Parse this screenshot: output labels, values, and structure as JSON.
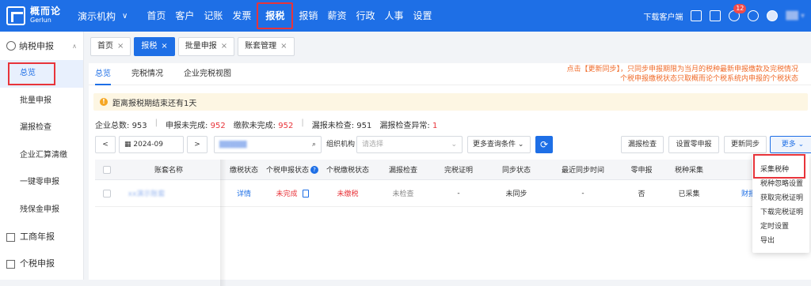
{
  "brand": {
    "name_cn": "概而论",
    "name_en": "Gerlun"
  },
  "org": {
    "name": "演示机构"
  },
  "nav": [
    "首页",
    "客户",
    "记账",
    "发票",
    "报税",
    "报销",
    "薪资",
    "行政",
    "人事",
    "设置"
  ],
  "topright": {
    "download": "下载客户端",
    "badge": "12"
  },
  "sidebar": {
    "header": "纳税申报",
    "items": [
      "总览",
      "批量申报",
      "漏报检查",
      "企业汇算清缴",
      "一键零申报",
      "残保金申报"
    ],
    "sections": [
      "工商年报",
      "个税申报"
    ]
  },
  "tabs": [
    {
      "label": "首页",
      "close": "×"
    },
    {
      "label": "报税",
      "close": "×"
    },
    {
      "label": "批量申报",
      "close": "×"
    },
    {
      "label": "账套管理",
      "close": "×"
    }
  ],
  "subtabs": [
    "总览",
    "完税情况",
    "企业完税视图"
  ],
  "notice": {
    "line1": "点击【更新同步】，只同步申报期限为当月的税种最新申报缴款及完税情况",
    "line2": "个税申报缴税状态只取概而论个税系统内申报的个税状态"
  },
  "alert": {
    "icon": "!",
    "text": "距离报税期结束还有1天"
  },
  "stats": {
    "total_label": "企业总数:",
    "total": "953",
    "unfiled_label": "申报未完成:",
    "unfiled": "952",
    "unpaid_label": "缴款未完成:",
    "unpaid": "952",
    "unchecked_label": "漏报未检查:",
    "unchecked": "951",
    "abnormal_label": "漏报检查异常:",
    "abnormal": "1",
    "sep": "|"
  },
  "toolbar": {
    "prev": "<",
    "next": ">",
    "period": "2024-09",
    "org_label": "组织机构",
    "org_placeholder": "请选择",
    "more_filters": "更多查询条件",
    "btn_check": "漏报检查",
    "btn_zero": "设置零申报",
    "btn_sync": "更新同步",
    "btn_more": "更多"
  },
  "table": {
    "headers": [
      "账套名称",
      "缴税状态",
      "个税申报状态",
      "个税缴税状态",
      "漏报检查",
      "完税证明",
      "同步状态",
      "最近同步时间",
      "零申报",
      "税种采集"
    ],
    "row": {
      "name": "xx演示账套",
      "tax_detail": "详情",
      "iit_status": "未完成",
      "iit_pay": "未缴税",
      "check": "未检查",
      "proof": "-",
      "sync": "未同步",
      "last_sync": "-",
      "zero": "否",
      "collect": "已采集",
      "op": "财报"
    }
  },
  "dropdown": [
    "采集税种",
    "税种忽略设置",
    "获取完税证明",
    "下载完税证明",
    "定时设置",
    "导出"
  ]
}
